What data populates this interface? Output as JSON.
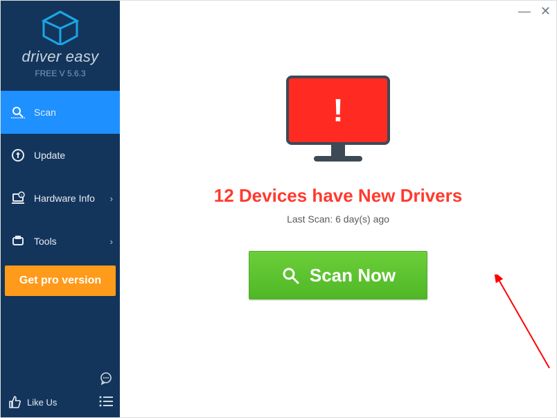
{
  "brand": "driver easy",
  "version": "FREE V 5.6.3",
  "sidebar": {
    "items": [
      {
        "label": "Scan"
      },
      {
        "label": "Update"
      },
      {
        "label": "Hardware Info"
      },
      {
        "label": "Tools"
      }
    ],
    "pro_label": "Get pro version",
    "likeus_label": "Like Us"
  },
  "main": {
    "headline": "12 Devices have New Drivers",
    "last_scan": "Last Scan: 6 day(s) ago",
    "scan_button": "Scan Now"
  },
  "colors": {
    "sidebar_bg": "#14355b",
    "accent": "#1e90ff",
    "pro": "#ff9a1a",
    "danger": "#ff3a2f",
    "scan_green": "#55bf2c"
  }
}
